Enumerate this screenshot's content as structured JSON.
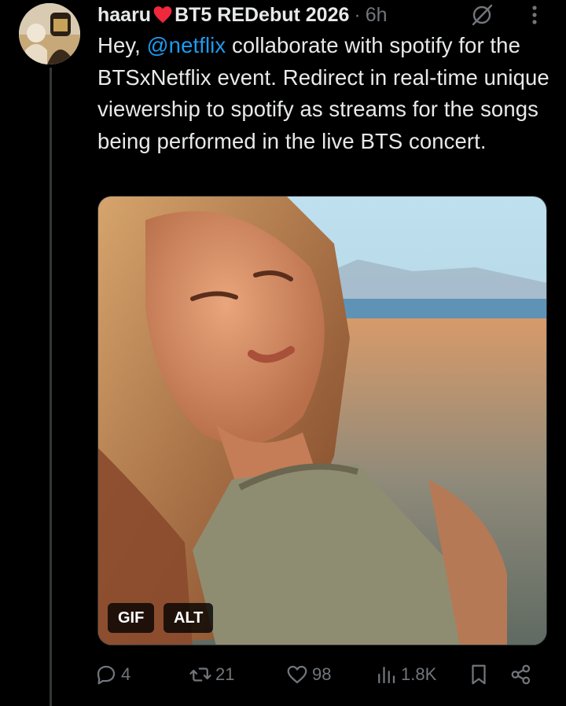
{
  "tweet": {
    "author_name": "haaru",
    "author_suffix": "BT5 REDebut 2026",
    "separator": "·",
    "time": "6h",
    "text_prefix": "Hey,",
    "mention": "@netflix",
    "text_body": "collaborate with spotify for the BTSxNetflix event. Redirect in real-time unique viewership to spotify as streams for the songs being performed in the live BTS concert."
  },
  "media": {
    "gif_badge": "GIF",
    "alt_badge": "ALT"
  },
  "actions": {
    "replies": "4",
    "reposts": "21",
    "likes": "98",
    "views": "1.8K"
  },
  "colors": {
    "background": "#000000",
    "text": "#e7e9ea",
    "muted": "#71767b",
    "link": "#1d9bf0",
    "heart": "#f0283c"
  },
  "icons": [
    "grok-icon",
    "more-icon",
    "reply-icon",
    "repost-icon",
    "like-icon",
    "views-icon",
    "bookmark-icon",
    "share-icon"
  ]
}
